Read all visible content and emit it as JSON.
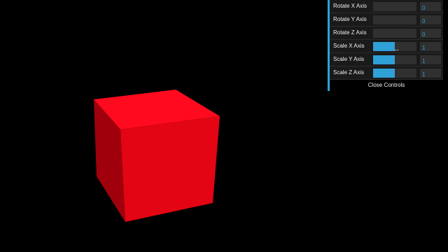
{
  "controls": [
    {
      "label": "Rotate X Axis",
      "value": "0",
      "fraction": 0.0
    },
    {
      "label": "Rotate Y Axis",
      "value": "0",
      "fraction": 0.0
    },
    {
      "label": "Rotate Z Axis",
      "value": "0",
      "fraction": 0.0
    },
    {
      "label": "Scale X Axis",
      "value": "1",
      "fraction": 0.5
    },
    {
      "label": "Scale Y Axis",
      "value": "1",
      "fraction": 0.5
    },
    {
      "label": "Scale Z Axis",
      "value": "1",
      "fraction": 0.5
    }
  ],
  "close_label": "Close Controls",
  "colors": {
    "background": "#000000",
    "cube_front": "#e30513",
    "cube_top": "#ff0a1e",
    "cube_side": "#a0000b",
    "accent": "#2fa1d6"
  },
  "cursor_icon": "resize-horizontal-icon"
}
